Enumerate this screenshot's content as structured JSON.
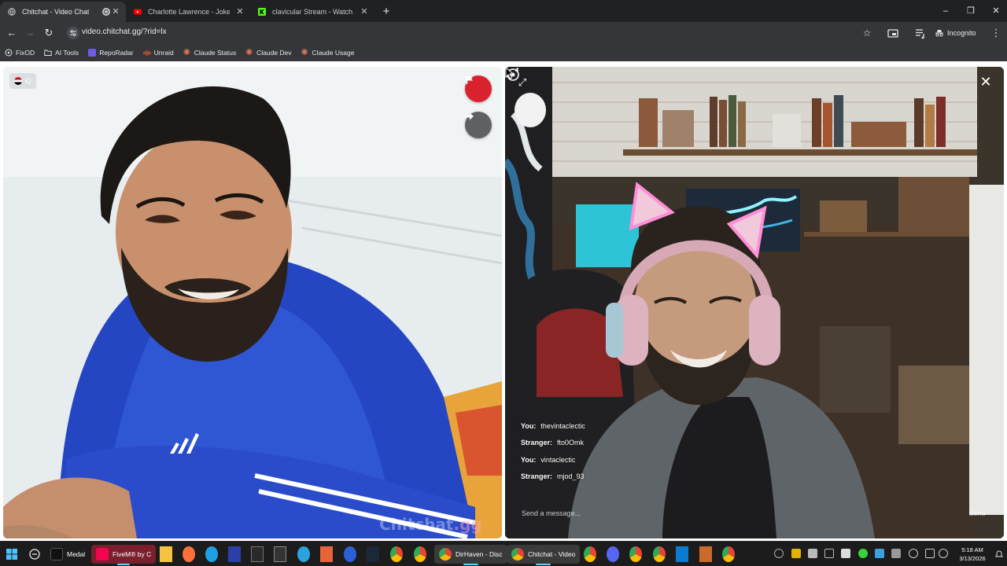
{
  "browser": {
    "tabs": [
      {
        "title": "Chitchat - Video Chat",
        "active": true
      },
      {
        "title": "Charlotte Lawrence - Joke's On",
        "active": false
      },
      {
        "title": "clavicular Stream - Watch Live o",
        "active": false
      }
    ],
    "window_controls": {
      "minimize": "–",
      "restore": "❐",
      "close": "✕"
    },
    "address": "video.chitchat.gg/?rid=lx",
    "incognito_label": "Incognito",
    "bookmarks": [
      {
        "label": "FixOD",
        "icon": "fixod-icon"
      },
      {
        "label": "AI Tools",
        "icon": "folder-icon"
      },
      {
        "label": "RepoRadar",
        "icon": "reporadar-icon"
      },
      {
        "label": "Unraid",
        "icon": "unraid-icon"
      },
      {
        "label": "Claude Status",
        "icon": "claude-icon"
      },
      {
        "label": "Claude Dev",
        "icon": "claude-icon"
      },
      {
        "label": "Claude Usage",
        "icon": "claude-icon"
      }
    ]
  },
  "chitchat": {
    "stranger_country": "IQ",
    "watermark_main": "Chitchat",
    "watermark_suffix": ".gg",
    "chat": [
      {
        "who": "You:",
        "text": "thevintaclectic"
      },
      {
        "who": "Stranger:",
        "text": "fto0Omk"
      },
      {
        "who": "You:",
        "text": "vintaclectic"
      },
      {
        "who": "Stranger:",
        "text": "mjod_93"
      }
    ],
    "message_placeholder": "Send a message...",
    "send_label": "Send"
  },
  "taskbar": {
    "apps": [
      {
        "label": "Medal"
      },
      {
        "label": "FiveM® by C"
      },
      {
        "label": "DirHaven - Disc"
      },
      {
        "label": "Chitchat - Video"
      }
    ],
    "time": "5:18 AM",
    "date": "3/13/2026"
  },
  "colors": {
    "report_red": "#d8232f",
    "chrome_bg": "#202124",
    "toolbar_bg": "#35363a",
    "taskbar_bg": "#1c1c1c"
  }
}
